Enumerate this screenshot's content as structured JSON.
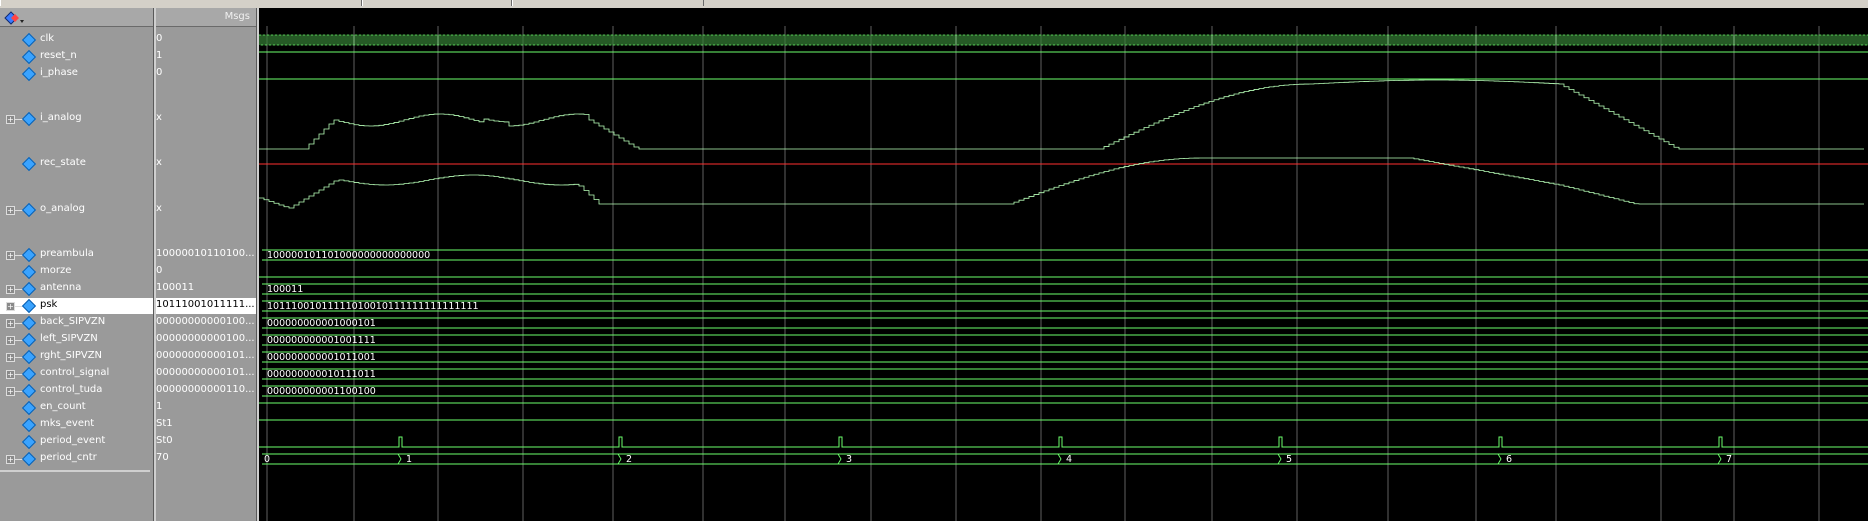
{
  "toolbar": {
    "icon": "wave-window-icon"
  },
  "headers": {
    "values": "Msgs"
  },
  "signals": [
    {
      "name": "clk",
      "value": "0",
      "expandable": false
    },
    {
      "name": "reset_n",
      "value": "1",
      "expandable": false
    },
    {
      "name": "i_phase",
      "value": "0",
      "expandable": false
    },
    {
      "name": "i_analog",
      "value": "x",
      "expandable": true
    },
    {
      "name": "rec_state",
      "value": "x",
      "expandable": false
    },
    {
      "name": "o_analog",
      "value": "x",
      "expandable": true
    },
    {
      "name": "preambula",
      "value": "10000010110100...",
      "expandable": true,
      "bus": "100000101101000000000000000"
    },
    {
      "name": "morze",
      "value": "0",
      "expandable": false
    },
    {
      "name": "antenna",
      "value": "100011",
      "expandable": true,
      "bus": "100011"
    },
    {
      "name": "psk",
      "value": "10111001011111...",
      "expandable": true,
      "bus": "10111001011111010010111111111111111",
      "selected": true
    },
    {
      "name": "back_SIPVZN",
      "value": "00000000000100...",
      "expandable": true,
      "bus": "000000000001000101"
    },
    {
      "name": "left_SIPVZN",
      "value": "00000000000100...",
      "expandable": true,
      "bus": "000000000001001111"
    },
    {
      "name": "rght_SIPVZN",
      "value": "00000000000101...",
      "expandable": true,
      "bus": "000000000001011001"
    },
    {
      "name": "control_signal",
      "value": "00000000000101...",
      "expandable": true,
      "bus": "000000000010111011"
    },
    {
      "name": "control_tuda",
      "value": "00000000000110...",
      "expandable": true,
      "bus": "000000000001100100"
    },
    {
      "name": "en_count",
      "value": "1",
      "expandable": false
    },
    {
      "name": "mks_event",
      "value": "St1",
      "expandable": false
    },
    {
      "name": "period_event",
      "value": "St0",
      "expandable": false
    },
    {
      "name": "period_cntr",
      "value": "70",
      "expandable": true
    }
  ],
  "period_cntr_labels": [
    "0",
    "1",
    "2",
    "3",
    "4",
    "5",
    "6",
    "7"
  ],
  "colors": {
    "wave": "#6cff6c",
    "red": "#ff3030",
    "grid": "#ffffff",
    "bg": "#000000"
  }
}
